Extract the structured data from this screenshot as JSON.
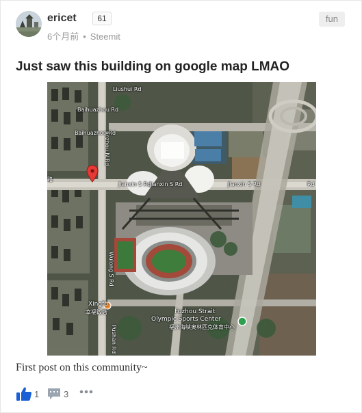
{
  "post": {
    "author": {
      "name": "ericet",
      "reputation": "61"
    },
    "meta": {
      "time": "6个月前",
      "separator": "•",
      "source": "Steemit"
    },
    "tag": "fun",
    "title": "Just saw this building on google map LMAO",
    "body": "First post on this community~",
    "actions": {
      "votes": "1",
      "comments": "3"
    }
  },
  "map": {
    "labels": {
      "liushui_rd": "Liushui Rd",
      "baihuazhou_rd_1": "Baihuazhou Rd",
      "baihuazhou_rd_2": "Baihuazhou Rd",
      "jinzhou_n_rd": "Jinzhou N Rd",
      "jianxin_s_rd_1": "Jianxin S Rd",
      "jianxin_s_rd_2": "Jianxin S Rd",
      "jianxin_s_rd_3": "Jianxin S Rd",
      "wulong_s_rd": "Wulong S Rd",
      "pushan_rd": "Pushan Rd",
      "xingfu": "Xingfu",
      "xingfu_cn": "幸福饭店",
      "stadium_1": "Fuzhou Strait",
      "stadium_2": "Olympic Sports Center",
      "stadium_cn": "福州海峡奥林匹克体育中心",
      "edge_r": "Rd",
      "edge_l": "路"
    },
    "colors": {
      "marker": "#e53935",
      "park_marker": "#2e9e4f",
      "water": "#3a7db8"
    }
  },
  "colors": {
    "accent": "#1a5fd6",
    "muted": "#9a9a9a"
  },
  "icons": {
    "vote": "thumbs-up-icon",
    "comment": "comment-icon",
    "more": "more-icon"
  }
}
